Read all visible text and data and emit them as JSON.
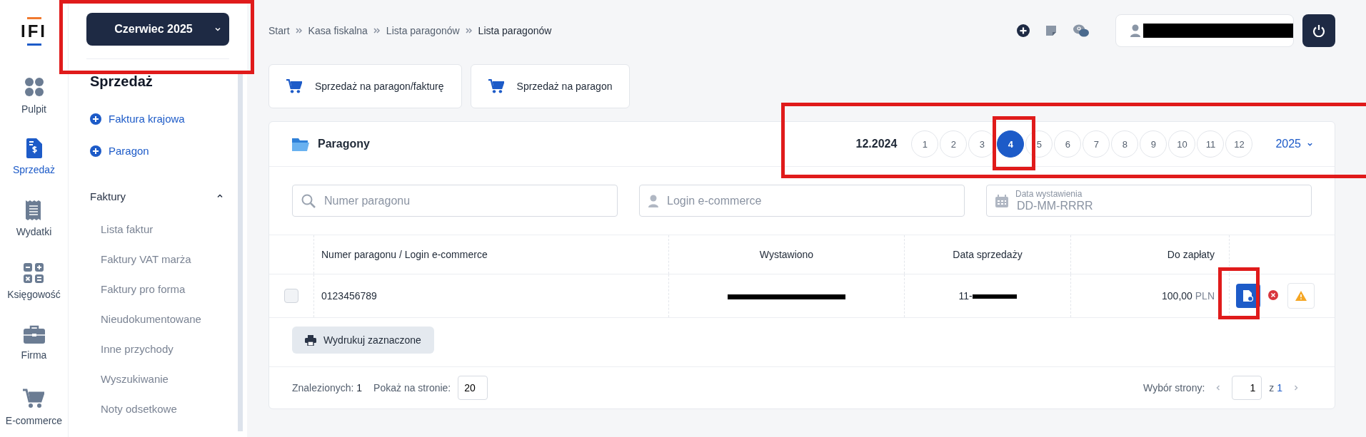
{
  "logo": {
    "text": "IFI"
  },
  "rail": [
    {
      "label": "Pulpit",
      "kind": "dots",
      "selected": false
    },
    {
      "label": "Sprzedaż",
      "kind": "invoice",
      "selected": true
    },
    {
      "label": "Wydatki",
      "kind": "receipt",
      "selected": false
    },
    {
      "label": "Księgowość",
      "kind": "calc",
      "selected": false
    },
    {
      "label": "Firma",
      "kind": "briefcase",
      "selected": false
    },
    {
      "label": "E-commerce",
      "kind": "cart",
      "selected": false
    }
  ],
  "month_button": {
    "label": "Czerwiec 2025"
  },
  "sidebar": {
    "title": "Sprzedaż",
    "actions": [
      "Faktura krajowa",
      "Paragon"
    ],
    "section": {
      "label": "Faktury",
      "expanded": true,
      "children": [
        "Lista faktur",
        "Faktury VAT marża",
        "Faktury pro forma",
        "Nieudokumentowane",
        "Inne przychody",
        "Wyszukiwanie",
        "Noty odsetkowe"
      ]
    }
  },
  "breadcrumb": [
    "Start",
    "Kasa fiskalna",
    "Lista paragonów",
    "Lista paragonów"
  ],
  "quick_actions": [
    "Sprzedaż na paragon/fakturę",
    "Sprzedaż na paragon"
  ],
  "card": {
    "title": "Paragony",
    "period": "12.2024",
    "year": "2025",
    "months": [
      {
        "label": "1",
        "selected": false
      },
      {
        "label": "2",
        "selected": false
      },
      {
        "label": "3",
        "selected": false
      },
      {
        "label": "4",
        "selected": true
      },
      {
        "label": "5",
        "selected": false
      },
      {
        "label": "6",
        "selected": false
      },
      {
        "label": "7",
        "selected": false
      },
      {
        "label": "8",
        "selected": false
      },
      {
        "label": "9",
        "selected": false
      },
      {
        "label": "10",
        "selected": false
      },
      {
        "label": "11",
        "selected": false
      },
      {
        "label": "12",
        "selected": false
      }
    ]
  },
  "filters": [
    {
      "kind": "search",
      "placeholder": "Numer paragonu"
    },
    {
      "kind": "user",
      "placeholder": "Login e-commerce"
    },
    {
      "kind": "date",
      "label": "Data wystawienia",
      "placeholder": "DD-MM-RRRR"
    }
  ],
  "table": {
    "columns": [
      "Numer paragonu / Login e-commerce",
      "Wystawiono",
      "Data sprzedaży",
      "Do zapłaty"
    ],
    "rows": [
      {
        "checked": false,
        "number": "0123456789",
        "sale_date": "11-",
        "amount": "100,00",
        "currency": "PLN"
      }
    ]
  },
  "print_button": "Wydrukuj zaznaczone",
  "footer": {
    "found_label": "Znalezionych:",
    "found": "1",
    "per_page_label": "Pokaż na stronie:",
    "per_page": "20",
    "page_label": "Wybór strony:",
    "page": "1",
    "of": "z",
    "pages": "1"
  }
}
